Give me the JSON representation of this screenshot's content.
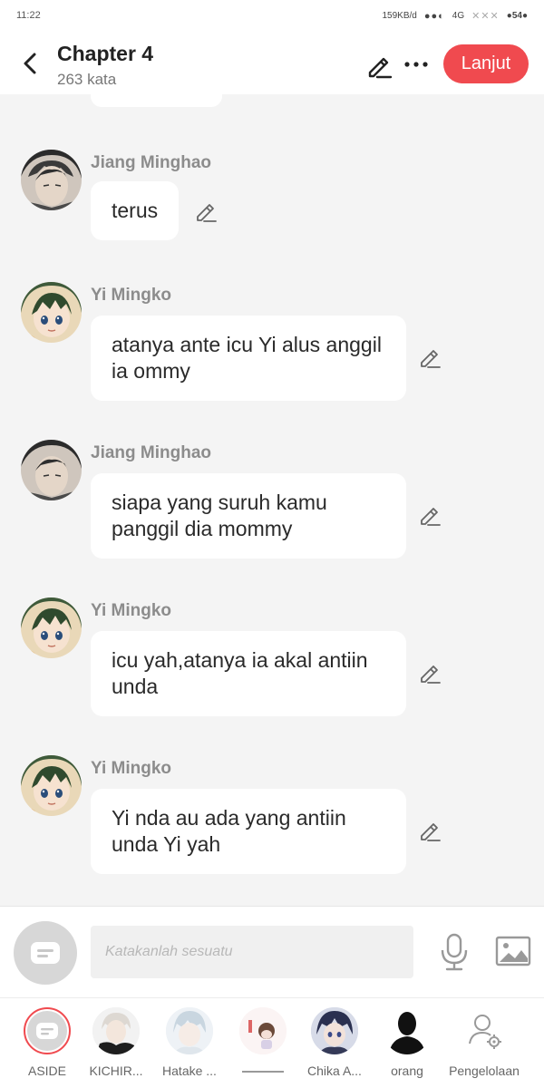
{
  "status": {
    "time": "11:22",
    "network": "159KB/d",
    "signal": "4G",
    "battery": "54"
  },
  "header": {
    "title": "Chapter 4",
    "subtitle": "263 kata",
    "next_label": "Lanjut"
  },
  "messages": [
    {
      "name": "Jiang Minghao",
      "text": "terus",
      "avatar": "jiang-avatar"
    },
    {
      "name": "Yi Mingko",
      "text": "atanya ante icu Yi alus anggil ia ommy",
      "avatar": "yi-avatar"
    },
    {
      "name": "Jiang Minghao",
      "text": "siapa yang suruh kamu panggil dia mommy",
      "avatar": "jiang-avatar"
    },
    {
      "name": "Yi Mingko",
      "text": "icu yah,atanya ia akal antiin unda",
      "avatar": "yi-avatar"
    },
    {
      "name": "Yi Mingko",
      "text": "Yi nda au ada yang antiin unda Yi yah",
      "avatar": "yi-avatar"
    }
  ],
  "input": {
    "placeholder": "Katakanlah sesuatu"
  },
  "characters": [
    {
      "label": "ASIDE"
    },
    {
      "label": "KICHIR..."
    },
    {
      "label": "Hatake ..."
    },
    {
      "label": ""
    },
    {
      "label": "Chika A..."
    },
    {
      "label": "orang"
    },
    {
      "label": "Pengelolaan"
    }
  ],
  "colors": {
    "accent": "#f04a4f",
    "background": "#f4f4f4"
  }
}
